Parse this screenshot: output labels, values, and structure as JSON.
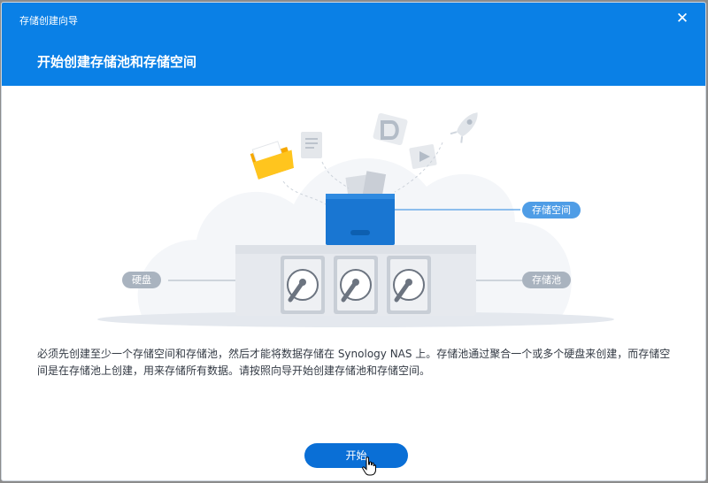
{
  "window": {
    "title": "存储创建向导",
    "close_icon": "close-icon",
    "wizard_title": "开始创建存储池和存储空间"
  },
  "illustration": {
    "label_volume": "存储空间",
    "label_disk": "硬盘",
    "label_pool": "存储池"
  },
  "description": "必须先创建至少一个存储空间和存储池，然后才能将数据存储在 Synology NAS 上。存储池通过聚合一个或多个硬盘来创建，而存储空间是在存储池上创建，用来存储所有数据。请按照向导开始创建存储池和存储空间。",
  "footer": {
    "start_label": "开始"
  },
  "colors": {
    "header": "#0a80e6",
    "primary_button": "#0a6fd6",
    "pill_blue": "#4f9de6",
    "pill_gray": "#a9b3bf"
  }
}
